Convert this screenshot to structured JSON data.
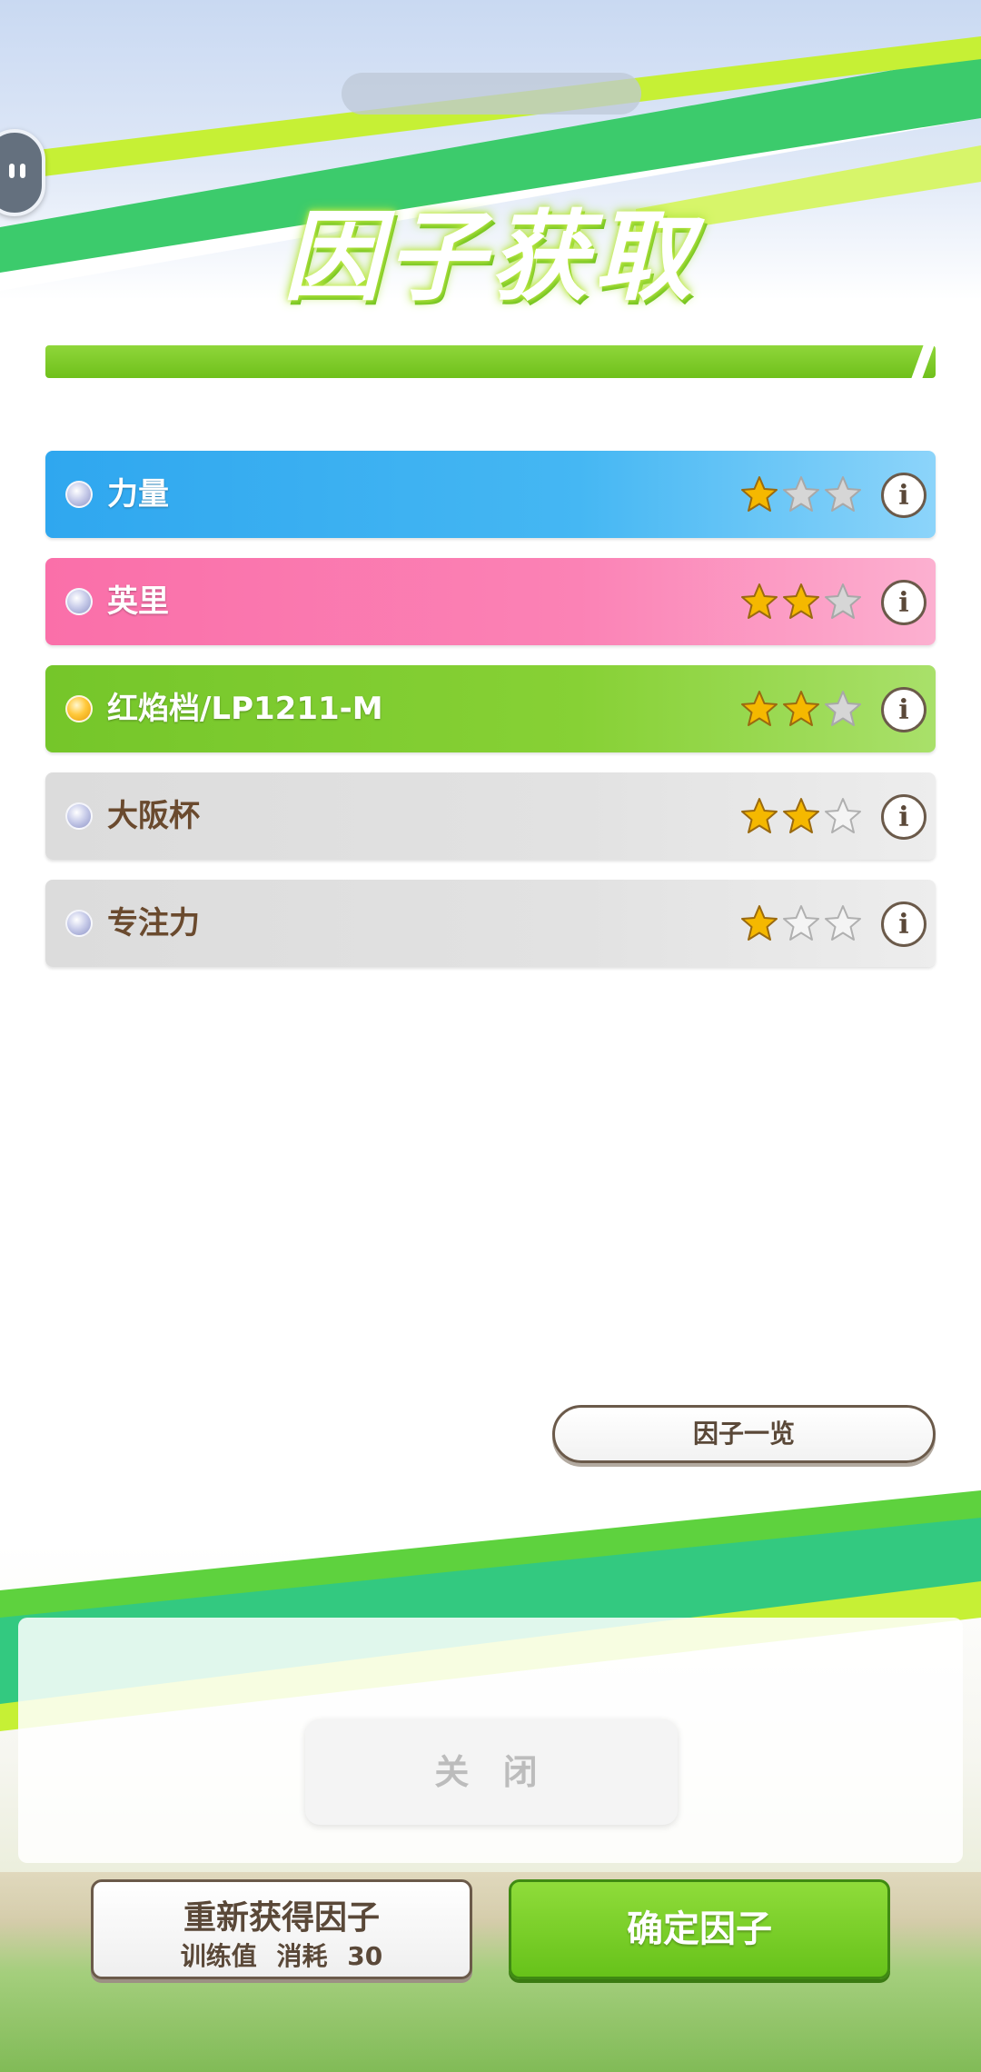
{
  "header": {
    "title": "因子获取"
  },
  "factors": [
    {
      "name": "力量",
      "stars_filled": 1,
      "stars_total": 3,
      "color": "#2fa7ef",
      "style": "blue"
    },
    {
      "name": "英里",
      "stars_filled": 2,
      "stars_total": 3,
      "color": "#fa6fa9",
      "style": "pink"
    },
    {
      "name": "红焰档/LP1211-M",
      "stars_filled": 2,
      "stars_total": 3,
      "color": "#75c62a",
      "style": "green"
    },
    {
      "name": "大阪杯",
      "stars_filled": 2,
      "stars_total": 3,
      "color": "#dcdcdc",
      "style": "gray"
    },
    {
      "name": "专注力",
      "stars_filled": 1,
      "stars_total": 3,
      "color": "#dcdcdc",
      "style": "gray"
    }
  ],
  "info_glyph": "i",
  "factor_list_button": "因子一览",
  "background_close_label": "关 闭",
  "regen_button": {
    "title": "重新获得因子",
    "cost_label": "训练值",
    "cost_action": "消耗",
    "cost_value": "30"
  },
  "confirm_button": "确定因子",
  "colors": {
    "accent_green": "#6fc01b",
    "brown_text": "#5a4838",
    "star_gold": "#f5b800"
  }
}
